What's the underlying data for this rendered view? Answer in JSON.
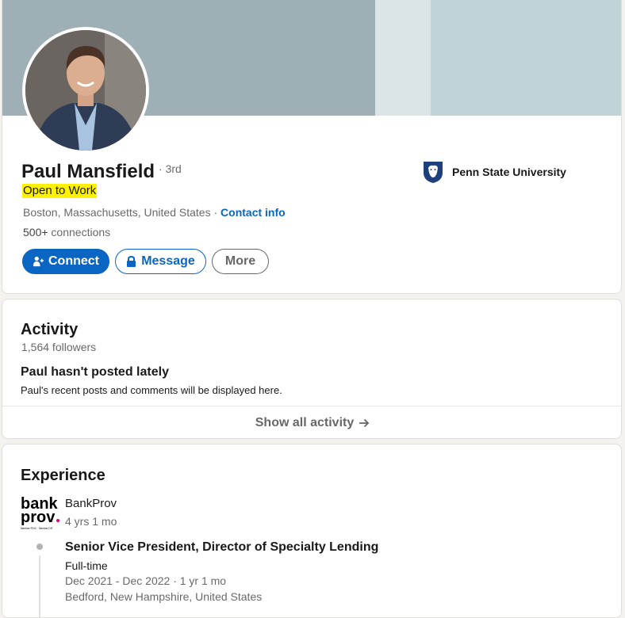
{
  "profile": {
    "name": "Paul Mansfield",
    "degree": "· 3rd",
    "open_to_work": "Open to Work",
    "location": "Boston, Massachusetts, United States",
    "separator": " · ",
    "contact_info": "Contact info",
    "connections_count": "500+",
    "connections_label": " connections",
    "school": "Penn State University",
    "buttons": {
      "connect": "Connect",
      "message": "Message",
      "more": "More"
    },
    "colors": {
      "primary": "#0a66c2",
      "open_to_work_highlight": "#fff200"
    }
  },
  "activity": {
    "title": "Activity",
    "followers": "1,564 followers",
    "headline": "Paul hasn't posted lately",
    "description": "Paul's recent posts and comments will be displayed here.",
    "show_all": "Show all activity"
  },
  "experience": {
    "title": "Experience",
    "company_logo": {
      "line1": "bank",
      "line2": "prov",
      "small": "Member FDIC · Member DIF"
    },
    "company": "BankProv",
    "duration": "4 yrs 1 mo",
    "role": "Senior Vice President, Director of Specialty Lending",
    "employment_type": "Full-time",
    "dates": "Dec 2021 - Dec 2022 · 1 yr 1 mo",
    "location": "Bedford, New Hampshire, United States"
  }
}
